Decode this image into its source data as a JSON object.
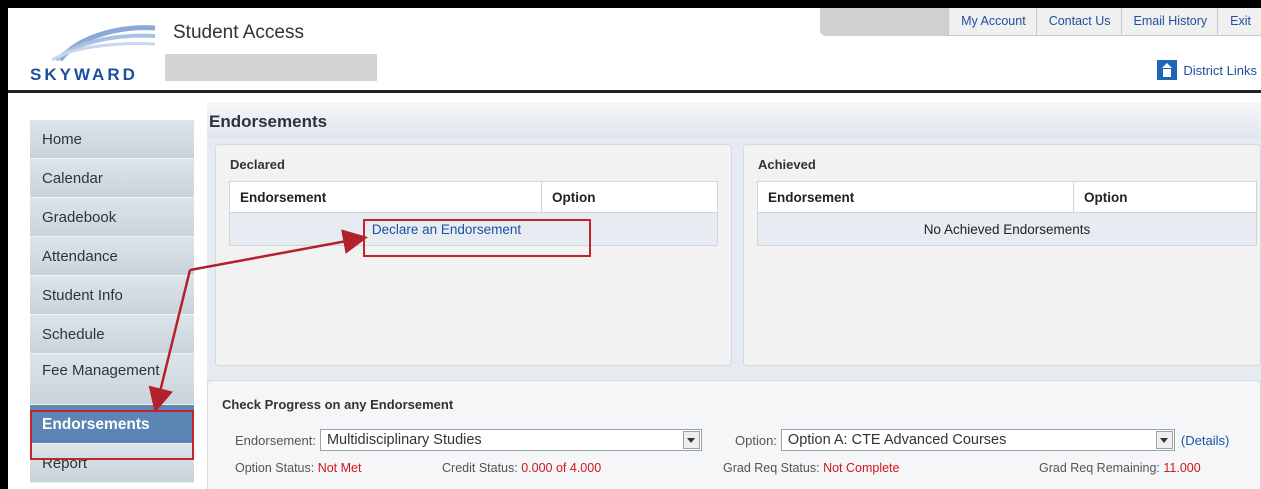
{
  "header": {
    "app_title": "Student Access",
    "logo_text": "SKYWARD",
    "district_links": "District Links",
    "top_links": [
      "My Account",
      "Contact Us",
      "Email History",
      "Exit"
    ]
  },
  "sidebar": {
    "items": [
      "Home",
      "Calendar",
      "Gradebook",
      "Attendance",
      "Student Info",
      "Schedule",
      "Fee Management",
      "Endorsements",
      "Report"
    ],
    "active": "Endorsements"
  },
  "main": {
    "title": "Endorsements",
    "declared": {
      "title": "Declared",
      "columns": [
        "Endorsement",
        "Option"
      ],
      "action_link": "Declare an Endorsement"
    },
    "achieved": {
      "title": "Achieved",
      "columns": [
        "Endorsement",
        "Option"
      ],
      "empty_text": "No Achieved Endorsements"
    },
    "progress": {
      "title": "Check Progress on any Endorsement",
      "endorsement_label": "Endorsement:",
      "endorsement_value": "Multidisciplinary Studies",
      "option_label": "Option:",
      "option_value": "Option A: CTE Advanced Courses",
      "details_link": "(Details)",
      "option_status_label": "Option Status:",
      "option_status_value": "Not Met",
      "credit_status_label": "Credit Status:",
      "credit_status_value": "0.000 of 4.000",
      "grad_req_status_label": "Grad Req Status:",
      "grad_req_status_value": "Not Complete",
      "grad_req_remaining_label": "Grad Req Remaining:",
      "grad_req_remaining_value": "11.000"
    }
  },
  "colors": {
    "accent": "#5c84b4",
    "link": "#1c53a3",
    "annotation": "#c0262c",
    "status_red": "#d0171b"
  }
}
